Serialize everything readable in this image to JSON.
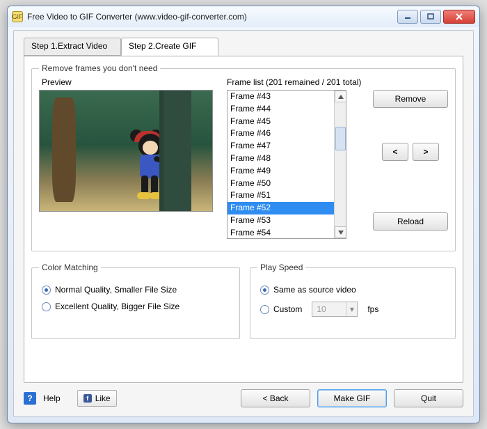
{
  "window": {
    "title": "Free Video to GIF Converter (www.video-gif-converter.com)"
  },
  "tabs": {
    "tab1": "Step 1.Extract Video",
    "tab2": "Step 2.Create GIF"
  },
  "frames_section": {
    "legend": "Remove frames you don't need",
    "preview_label": "Preview",
    "list_label": "Frame list (201 remained / 201 total)",
    "remove_label": "Remove",
    "prev_label": "<",
    "next_label": ">",
    "reload_label": "Reload",
    "items": [
      {
        "label": "Frame #43"
      },
      {
        "label": "Frame #44"
      },
      {
        "label": "Frame #45"
      },
      {
        "label": "Frame #46"
      },
      {
        "label": "Frame #47"
      },
      {
        "label": "Frame #48"
      },
      {
        "label": "Frame #49"
      },
      {
        "label": "Frame #50"
      },
      {
        "label": "Frame #51"
      },
      {
        "label": "Frame #52"
      },
      {
        "label": "Frame #53"
      },
      {
        "label": "Frame #54"
      }
    ],
    "selected_index": 9
  },
  "color_matching": {
    "legend": "Color Matching",
    "option_normal": "Normal Quality, Smaller File Size",
    "option_excellent": "Excellent Quality, Bigger File Size",
    "selected": "normal"
  },
  "play_speed": {
    "legend": "Play Speed",
    "option_same": "Same as source video",
    "option_custom": "Custom",
    "custom_value": "10",
    "unit": "fps",
    "selected": "same"
  },
  "footer": {
    "help_label": "Help",
    "like_label": "Like",
    "back_label": "< Back",
    "make_label": "Make GIF",
    "quit_label": "Quit"
  }
}
